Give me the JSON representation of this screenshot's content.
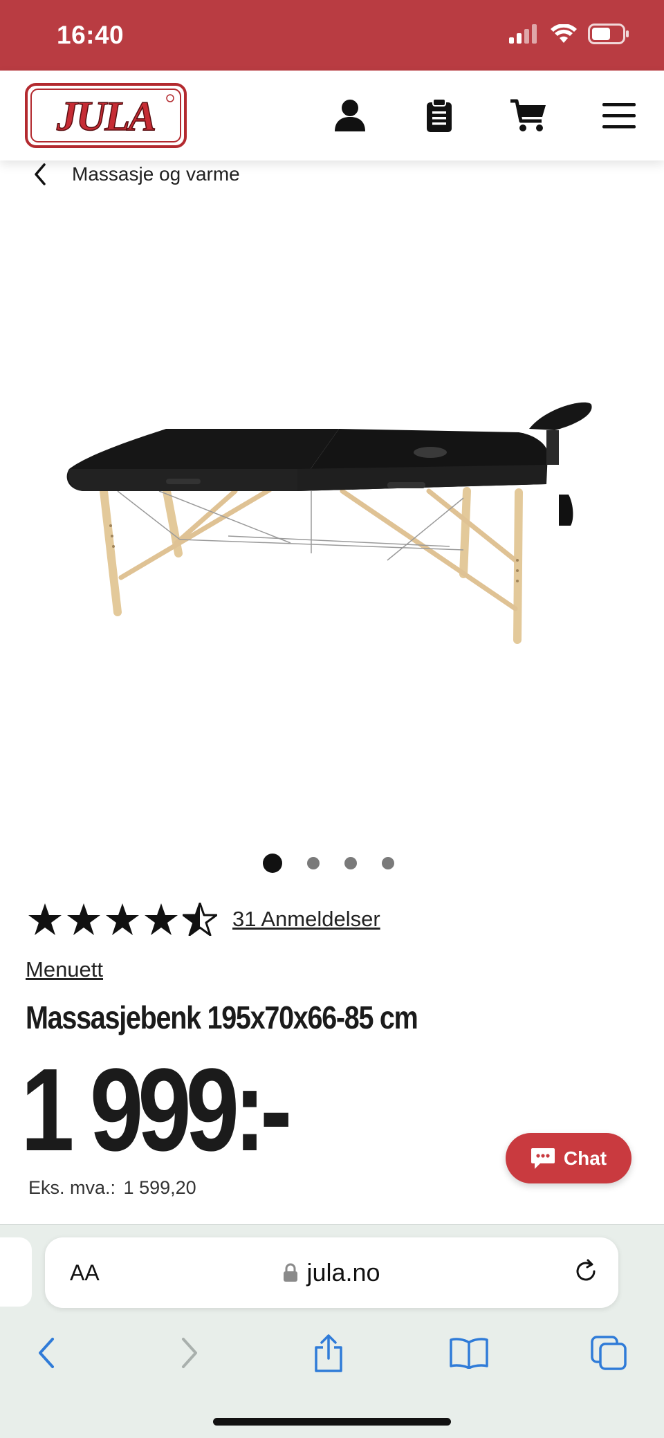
{
  "status_bar": {
    "time": "16:40"
  },
  "header": {
    "logo_text": "JULA",
    "icons": [
      "account-icon",
      "clipboard-icon",
      "cart-icon",
      "menu-icon"
    ]
  },
  "breadcrumb": {
    "label": "Massasje og varme"
  },
  "carousel": {
    "count": 4,
    "active_index": 0
  },
  "product": {
    "rating": 4.5,
    "reviews_link": "31 Anmeldelser",
    "brand": "Menuett",
    "title": "Massasjebenk 195x70x66-85 cm",
    "price": "1 999:-",
    "vat_label": "Eks. mva.:",
    "vat_value": "1 599,20"
  },
  "chat": {
    "label": "Chat"
  },
  "browser": {
    "text_size_label": "AA",
    "url": "jula.no"
  },
  "colors": {
    "brand_red": "#b93c42",
    "chat_red": "#c93a3f",
    "browser_blue": "#2f7bd8"
  }
}
